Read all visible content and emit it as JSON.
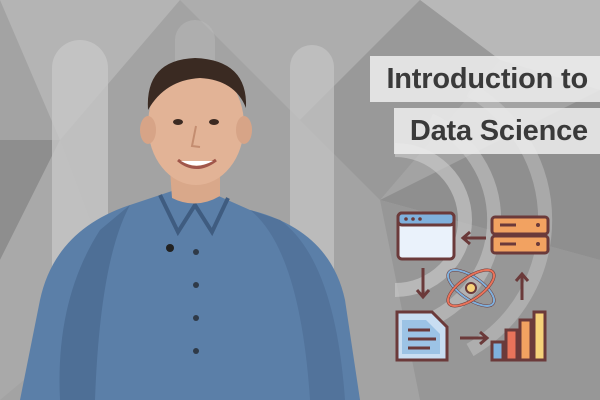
{
  "title": {
    "line1": "Introduction to",
    "line2": "Data Science"
  },
  "colors": {
    "background": "#9c9c9c",
    "title_text": "#3a3a3a",
    "title_box": "#ececec",
    "shirt": "#5b7fa8",
    "icon_outline": "#6b3a3a",
    "icon_blue": "#c9def2",
    "icon_orange": "#f2a261",
    "icon_red": "#e8735a",
    "icon_yellow": "#f6d27a"
  },
  "icons": [
    "browser-window-icon",
    "server-database-icon",
    "atom-icon",
    "document-icon",
    "bar-chart-icon",
    "arrow-left-icon",
    "arrow-up-icon",
    "arrow-down-icon",
    "arrow-right-icon"
  ]
}
